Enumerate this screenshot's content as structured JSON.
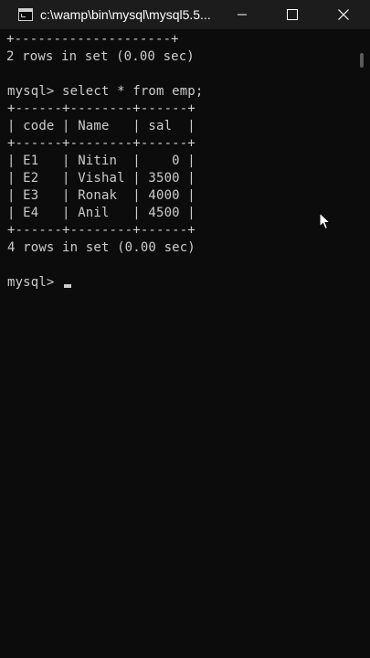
{
  "window": {
    "title": "c:\\wamp\\bin\\mysql\\mysql5.5..."
  },
  "terminal": {
    "lines": [
      "+--------------------+",
      "2 rows in set (0.00 sec)",
      "",
      "mysql> select * from emp;",
      "+------+--------+------+",
      "| code | Name   | sal  |",
      "+------+--------+------+",
      "| E1   | Nitin  |    0 |",
      "| E2   | Vishal | 3500 |",
      "| E3   | Ronak  | 4000 |",
      "| E4   | Anil   | 4500 |",
      "+------+--------+------+",
      "4 rows in set (0.00 sec)",
      "",
      "mysql> "
    ]
  },
  "colors": {
    "background": "#0c0c0c",
    "text": "#cccccc",
    "titlebar": "#1c1c1c"
  },
  "icons": {
    "app": "console-icon",
    "minimize": "minimize-icon",
    "maximize": "maximize-icon",
    "close": "close-icon",
    "pointer": "mouse-pointer-icon"
  }
}
